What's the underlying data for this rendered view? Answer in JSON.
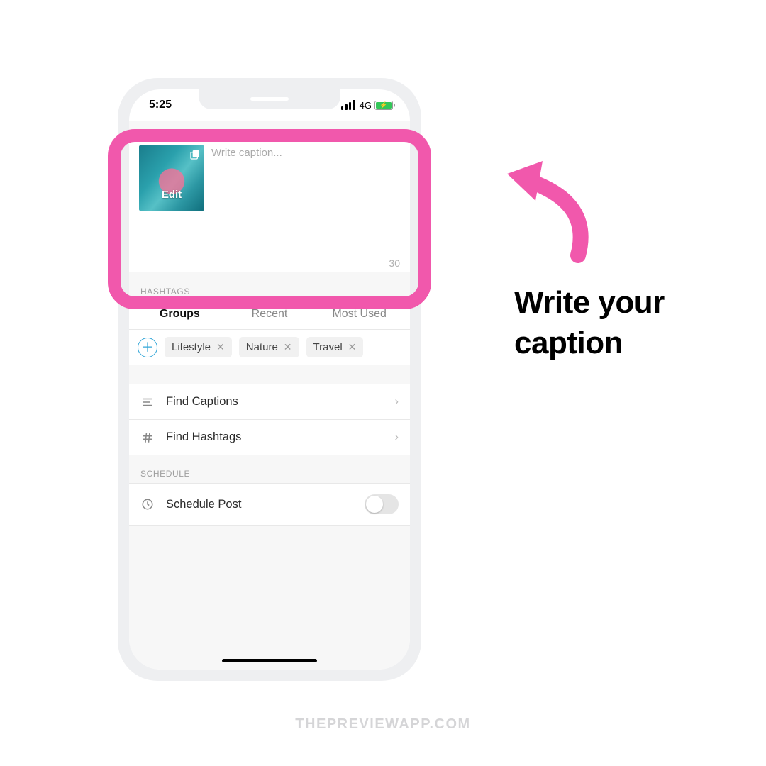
{
  "status": {
    "time": "5:25",
    "network": "4G"
  },
  "caption": {
    "placeholder": "Write caption...",
    "thumb_label": "Edit",
    "char_count": "30"
  },
  "hashtags": {
    "section_label": "HASHTAGS",
    "tabs": {
      "groups": "Groups",
      "recent": "Recent",
      "most_used": "Most Used"
    },
    "tags": [
      "Lifestyle",
      "Nature",
      "Travel"
    ]
  },
  "rows": {
    "find_captions": "Find Captions",
    "find_hashtags": "Find Hashtags"
  },
  "schedule": {
    "section_label": "SCHEDULE",
    "row_label": "Schedule Post"
  },
  "annotation": {
    "line1": "Write your",
    "line2": "caption"
  },
  "footer": "THEPREVIEWAPP.COM"
}
